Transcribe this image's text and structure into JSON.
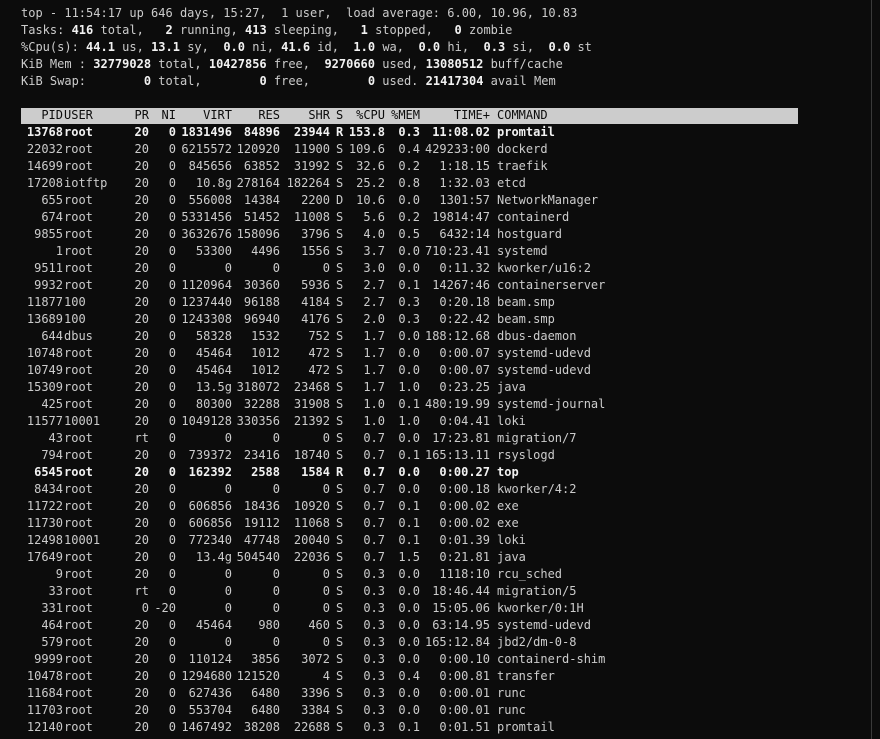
{
  "summary": {
    "line1": [
      {
        "t": "top - 11:54:17 up 646 days, 15:27,  1 user,  load average: 6.00, 10.96, 10.83",
        "b": false
      }
    ],
    "line2": [
      {
        "t": "Tasks: ",
        "b": false
      },
      {
        "t": "416",
        "b": true
      },
      {
        "t": " total,   ",
        "b": false
      },
      {
        "t": "2",
        "b": true
      },
      {
        "t": " running, ",
        "b": false
      },
      {
        "t": "413",
        "b": true
      },
      {
        "t": " sleeping,   ",
        "b": false
      },
      {
        "t": "1",
        "b": true
      },
      {
        "t": " stopped,   ",
        "b": false
      },
      {
        "t": "0",
        "b": true
      },
      {
        "t": " zombie",
        "b": false
      }
    ],
    "line3": [
      {
        "t": "%Cpu(s): ",
        "b": false
      },
      {
        "t": "44.1",
        "b": true
      },
      {
        "t": " us, ",
        "b": false
      },
      {
        "t": "13.1",
        "b": true
      },
      {
        "t": " sy,  ",
        "b": false
      },
      {
        "t": "0.0",
        "b": true
      },
      {
        "t": " ni, ",
        "b": false
      },
      {
        "t": "41.6",
        "b": true
      },
      {
        "t": " id,  ",
        "b": false
      },
      {
        "t": "1.0",
        "b": true
      },
      {
        "t": " wa,  ",
        "b": false
      },
      {
        "t": "0.0",
        "b": true
      },
      {
        "t": " hi,  ",
        "b": false
      },
      {
        "t": "0.3",
        "b": true
      },
      {
        "t": " si,  ",
        "b": false
      },
      {
        "t": "0.0",
        "b": true
      },
      {
        "t": " st",
        "b": false
      }
    ],
    "line4": [
      {
        "t": "KiB Mem : ",
        "b": false
      },
      {
        "t": "32779028",
        "b": true
      },
      {
        "t": " total, ",
        "b": false
      },
      {
        "t": "10427856",
        "b": true
      },
      {
        "t": " free,  ",
        "b": false
      },
      {
        "t": "9270660",
        "b": true
      },
      {
        "t": " used, ",
        "b": false
      },
      {
        "t": "13080512",
        "b": true
      },
      {
        "t": " buff/cache",
        "b": false
      }
    ],
    "line5": [
      {
        "t": "KiB Swap:        ",
        "b": false
      },
      {
        "t": "0",
        "b": true
      },
      {
        "t": " total,        ",
        "b": false
      },
      {
        "t": "0",
        "b": true
      },
      {
        "t": " free,        ",
        "b": false
      },
      {
        "t": "0",
        "b": true
      },
      {
        "t": " used. ",
        "b": false
      },
      {
        "t": "21417304",
        "b": true
      },
      {
        "t": " avail Mem",
        "b": false
      }
    ]
  },
  "columns": [
    "PID",
    "USER",
    "PR",
    "NI",
    "VIRT",
    "RES",
    "SHR",
    "S",
    "%CPU",
    "%MEM",
    "TIME+",
    "COMMAND"
  ],
  "processes": [
    {
      "pid": "13768",
      "user": "root",
      "pr": "20",
      "ni": "0",
      "virt": "1831496",
      "res": "84896",
      "shr": "23944",
      "s": "R",
      "cpu": "153.8",
      "mem": "0.3",
      "time": "11:08.02",
      "cmd": "promtail",
      "hl": true
    },
    {
      "pid": "22032",
      "user": "root",
      "pr": "20",
      "ni": "0",
      "virt": "6215572",
      "res": "120920",
      "shr": "11900",
      "s": "S",
      "cpu": "109.6",
      "mem": "0.4",
      "time": "429233:00",
      "cmd": "dockerd",
      "hl": false
    },
    {
      "pid": "14699",
      "user": "root",
      "pr": "20",
      "ni": "0",
      "virt": "845656",
      "res": "63852",
      "shr": "31992",
      "s": "S",
      "cpu": "32.6",
      "mem": "0.2",
      "time": "1:18.15",
      "cmd": "traefik",
      "hl": false
    },
    {
      "pid": "17208",
      "user": "iotftp",
      "pr": "20",
      "ni": "0",
      "virt": "10.8g",
      "res": "278164",
      "shr": "182264",
      "s": "S",
      "cpu": "25.2",
      "mem": "0.8",
      "time": "1:32.03",
      "cmd": "etcd",
      "hl": false
    },
    {
      "pid": "655",
      "user": "root",
      "pr": "20",
      "ni": "0",
      "virt": "556008",
      "res": "14384",
      "shr": "2200",
      "s": "D",
      "cpu": "10.6",
      "mem": "0.0",
      "time": "1301:57",
      "cmd": "NetworkManager",
      "hl": false
    },
    {
      "pid": "674",
      "user": "root",
      "pr": "20",
      "ni": "0",
      "virt": "5331456",
      "res": "51452",
      "shr": "11008",
      "s": "S",
      "cpu": "5.6",
      "mem": "0.2",
      "time": "19814:47",
      "cmd": "containerd",
      "hl": false
    },
    {
      "pid": "9855",
      "user": "root",
      "pr": "20",
      "ni": "0",
      "virt": "3632676",
      "res": "158096",
      "shr": "3796",
      "s": "S",
      "cpu": "4.0",
      "mem": "0.5",
      "time": "6432:14",
      "cmd": "hostguard",
      "hl": false
    },
    {
      "pid": "1",
      "user": "root",
      "pr": "20",
      "ni": "0",
      "virt": "53300",
      "res": "4496",
      "shr": "1556",
      "s": "S",
      "cpu": "3.7",
      "mem": "0.0",
      "time": "710:23.41",
      "cmd": "systemd",
      "hl": false
    },
    {
      "pid": "9511",
      "user": "root",
      "pr": "20",
      "ni": "0",
      "virt": "0",
      "res": "0",
      "shr": "0",
      "s": "S",
      "cpu": "3.0",
      "mem": "0.0",
      "time": "0:11.32",
      "cmd": "kworker/u16:2",
      "hl": false
    },
    {
      "pid": "9932",
      "user": "root",
      "pr": "20",
      "ni": "0",
      "virt": "1120964",
      "res": "30360",
      "shr": "5936",
      "s": "S",
      "cpu": "2.7",
      "mem": "0.1",
      "time": "14267:46",
      "cmd": "containerserver",
      "hl": false
    },
    {
      "pid": "11877",
      "user": "100",
      "pr": "20",
      "ni": "0",
      "virt": "1237440",
      "res": "96188",
      "shr": "4184",
      "s": "S",
      "cpu": "2.7",
      "mem": "0.3",
      "time": "0:20.18",
      "cmd": "beam.smp",
      "hl": false
    },
    {
      "pid": "13689",
      "user": "100",
      "pr": "20",
      "ni": "0",
      "virt": "1243308",
      "res": "96940",
      "shr": "4176",
      "s": "S",
      "cpu": "2.0",
      "mem": "0.3",
      "time": "0:22.42",
      "cmd": "beam.smp",
      "hl": false
    },
    {
      "pid": "644",
      "user": "dbus",
      "pr": "20",
      "ni": "0",
      "virt": "58328",
      "res": "1532",
      "shr": "752",
      "s": "S",
      "cpu": "1.7",
      "mem": "0.0",
      "time": "188:12.68",
      "cmd": "dbus-daemon",
      "hl": false
    },
    {
      "pid": "10748",
      "user": "root",
      "pr": "20",
      "ni": "0",
      "virt": "45464",
      "res": "1012",
      "shr": "472",
      "s": "S",
      "cpu": "1.7",
      "mem": "0.0",
      "time": "0:00.07",
      "cmd": "systemd-udevd",
      "hl": false
    },
    {
      "pid": "10749",
      "user": "root",
      "pr": "20",
      "ni": "0",
      "virt": "45464",
      "res": "1012",
      "shr": "472",
      "s": "S",
      "cpu": "1.7",
      "mem": "0.0",
      "time": "0:00.07",
      "cmd": "systemd-udevd",
      "hl": false
    },
    {
      "pid": "15309",
      "user": "root",
      "pr": "20",
      "ni": "0",
      "virt": "13.5g",
      "res": "318072",
      "shr": "23468",
      "s": "S",
      "cpu": "1.7",
      "mem": "1.0",
      "time": "0:23.25",
      "cmd": "java",
      "hl": false
    },
    {
      "pid": "425",
      "user": "root",
      "pr": "20",
      "ni": "0",
      "virt": "80300",
      "res": "32288",
      "shr": "31908",
      "s": "S",
      "cpu": "1.0",
      "mem": "0.1",
      "time": "480:19.99",
      "cmd": "systemd-journal",
      "hl": false
    },
    {
      "pid": "11577",
      "user": "10001",
      "pr": "20",
      "ni": "0",
      "virt": "1049128",
      "res": "330356",
      "shr": "21392",
      "s": "S",
      "cpu": "1.0",
      "mem": "1.0",
      "time": "0:04.41",
      "cmd": "loki",
      "hl": false
    },
    {
      "pid": "43",
      "user": "root",
      "pr": "rt",
      "ni": "0",
      "virt": "0",
      "res": "0",
      "shr": "0",
      "s": "S",
      "cpu": "0.7",
      "mem": "0.0",
      "time": "17:23.81",
      "cmd": "migration/7",
      "hl": false
    },
    {
      "pid": "794",
      "user": "root",
      "pr": "20",
      "ni": "0",
      "virt": "739372",
      "res": "23416",
      "shr": "18740",
      "s": "S",
      "cpu": "0.7",
      "mem": "0.1",
      "time": "165:13.11",
      "cmd": "rsyslogd",
      "hl": false
    },
    {
      "pid": "6545",
      "user": "root",
      "pr": "20",
      "ni": "0",
      "virt": "162392",
      "res": "2588",
      "shr": "1584",
      "s": "R",
      "cpu": "0.7",
      "mem": "0.0",
      "time": "0:00.27",
      "cmd": "top",
      "hl": true
    },
    {
      "pid": "8434",
      "user": "root",
      "pr": "20",
      "ni": "0",
      "virt": "0",
      "res": "0",
      "shr": "0",
      "s": "S",
      "cpu": "0.7",
      "mem": "0.0",
      "time": "0:00.18",
      "cmd": "kworker/4:2",
      "hl": false
    },
    {
      "pid": "11722",
      "user": "root",
      "pr": "20",
      "ni": "0",
      "virt": "606856",
      "res": "18436",
      "shr": "10920",
      "s": "S",
      "cpu": "0.7",
      "mem": "0.1",
      "time": "0:00.02",
      "cmd": "exe",
      "hl": false
    },
    {
      "pid": "11730",
      "user": "root",
      "pr": "20",
      "ni": "0",
      "virt": "606856",
      "res": "19112",
      "shr": "11068",
      "s": "S",
      "cpu": "0.7",
      "mem": "0.1",
      "time": "0:00.02",
      "cmd": "exe",
      "hl": false
    },
    {
      "pid": "12498",
      "user": "10001",
      "pr": "20",
      "ni": "0",
      "virt": "772340",
      "res": "47748",
      "shr": "20040",
      "s": "S",
      "cpu": "0.7",
      "mem": "0.1",
      "time": "0:01.39",
      "cmd": "loki",
      "hl": false
    },
    {
      "pid": "17649",
      "user": "root",
      "pr": "20",
      "ni": "0",
      "virt": "13.4g",
      "res": "504540",
      "shr": "22036",
      "s": "S",
      "cpu": "0.7",
      "mem": "1.5",
      "time": "0:21.81",
      "cmd": "java",
      "hl": false
    },
    {
      "pid": "9",
      "user": "root",
      "pr": "20",
      "ni": "0",
      "virt": "0",
      "res": "0",
      "shr": "0",
      "s": "S",
      "cpu": "0.3",
      "mem": "0.0",
      "time": "1118:10",
      "cmd": "rcu_sched",
      "hl": false
    },
    {
      "pid": "33",
      "user": "root",
      "pr": "rt",
      "ni": "0",
      "virt": "0",
      "res": "0",
      "shr": "0",
      "s": "S",
      "cpu": "0.3",
      "mem": "0.0",
      "time": "18:46.44",
      "cmd": "migration/5",
      "hl": false
    },
    {
      "pid": "331",
      "user": "root",
      "pr": "0",
      "ni": "-20",
      "virt": "0",
      "res": "0",
      "shr": "0",
      "s": "S",
      "cpu": "0.3",
      "mem": "0.0",
      "time": "15:05.06",
      "cmd": "kworker/0:1H",
      "hl": false
    },
    {
      "pid": "464",
      "user": "root",
      "pr": "20",
      "ni": "0",
      "virt": "45464",
      "res": "980",
      "shr": "460",
      "s": "S",
      "cpu": "0.3",
      "mem": "0.0",
      "time": "63:14.95",
      "cmd": "systemd-udevd",
      "hl": false
    },
    {
      "pid": "579",
      "user": "root",
      "pr": "20",
      "ni": "0",
      "virt": "0",
      "res": "0",
      "shr": "0",
      "s": "S",
      "cpu": "0.3",
      "mem": "0.0",
      "time": "165:12.84",
      "cmd": "jbd2/dm-0-8",
      "hl": false
    },
    {
      "pid": "9999",
      "user": "root",
      "pr": "20",
      "ni": "0",
      "virt": "110124",
      "res": "3856",
      "shr": "3072",
      "s": "S",
      "cpu": "0.3",
      "mem": "0.0",
      "time": "0:00.10",
      "cmd": "containerd-shim",
      "hl": false
    },
    {
      "pid": "10478",
      "user": "root",
      "pr": "20",
      "ni": "0",
      "virt": "1294680",
      "res": "121520",
      "shr": "4",
      "s": "S",
      "cpu": "0.3",
      "mem": "0.4",
      "time": "0:00.81",
      "cmd": "transfer",
      "hl": false
    },
    {
      "pid": "11684",
      "user": "root",
      "pr": "20",
      "ni": "0",
      "virt": "627436",
      "res": "6480",
      "shr": "3396",
      "s": "S",
      "cpu": "0.3",
      "mem": "0.0",
      "time": "0:00.01",
      "cmd": "runc",
      "hl": false
    },
    {
      "pid": "11703",
      "user": "root",
      "pr": "20",
      "ni": "0",
      "virt": "553704",
      "res": "6480",
      "shr": "3384",
      "s": "S",
      "cpu": "0.3",
      "mem": "0.0",
      "time": "0:00.01",
      "cmd": "runc",
      "hl": false
    },
    {
      "pid": "12140",
      "user": "root",
      "pr": "20",
      "ni": "0",
      "virt": "1467492",
      "res": "38208",
      "shr": "22688",
      "s": "S",
      "cpu": "0.3",
      "mem": "0.1",
      "time": "0:01.51",
      "cmd": "promtail",
      "hl": false
    }
  ]
}
